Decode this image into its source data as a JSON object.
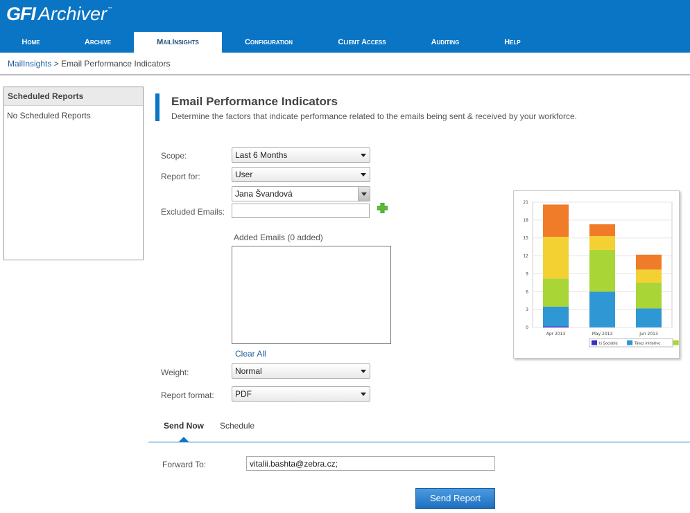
{
  "header": {
    "logo": {
      "brand": "GFI",
      "product": "Archiver",
      "tm": "™"
    },
    "nav": [
      {
        "label": "Home",
        "active": false
      },
      {
        "label": "Archive",
        "active": false
      },
      {
        "label": "MailInsights",
        "active": true
      },
      {
        "label": "Configuration",
        "active": false
      },
      {
        "label": "Client Access",
        "active": false
      },
      {
        "label": "Auditing",
        "active": false
      },
      {
        "label": "Help",
        "active": false
      }
    ]
  },
  "breadcrumb": {
    "link": "MailInsights",
    "separator": ">",
    "current": "Email Performance Indicators"
  },
  "sidebar": {
    "title": "Scheduled Reports",
    "empty_text": "No Scheduled Reports"
  },
  "page": {
    "title": "Email Performance Indicators",
    "description": "Determine the factors that indicate performance related to the emails being sent & received by your workforce."
  },
  "form": {
    "scope_label": "Scope:",
    "scope_value": "Last 6 Months",
    "report_for_label": "Report for:",
    "report_for_value": "User",
    "user_value": "Jana Švandová",
    "excluded_label": "Excluded Emails:",
    "excluded_value": "",
    "added_label": "Added Emails (0 added)",
    "clear_all": "Clear All",
    "weight_label": "Weight:",
    "weight_value": "Normal",
    "format_label": "Report format:",
    "format_value": "PDF"
  },
  "tabs": {
    "send_now": "Send Now",
    "schedule": "Schedule"
  },
  "send": {
    "forward_label": "Forward To:",
    "forward_value": "vitalii.bashta@zebra.cz;",
    "button": "Send Report"
  },
  "colors": {
    "accent": "#0a75c5",
    "add_icon": "#5bbf35"
  },
  "chart_data": {
    "type": "bar",
    "stacked": true,
    "categories": [
      "Apr 2013",
      "May 2013",
      "Jun 2013"
    ],
    "ylim": [
      0,
      21
    ],
    "yticks": [
      0,
      3,
      6,
      9,
      12,
      15,
      18,
      21
    ],
    "grid": true,
    "legend_position": "bottom-right",
    "series": [
      {
        "name": "",
        "color": "#3b2fc9",
        "values": [
          0.2,
          0,
          0
        ]
      },
      {
        "name": "",
        "color": "#2e97d4",
        "values": [
          3.3,
          6,
          3.2
        ]
      },
      {
        "name": "",
        "color": "#a9d536",
        "values": [
          4.7,
          7,
          4.3
        ]
      },
      {
        "name": "",
        "color": "#f3d133",
        "values": [
          7,
          2.3,
          2.2
        ]
      },
      {
        "name": "",
        "color": "#f07c2a",
        "values": [
          5.4,
          2,
          2.5
        ]
      }
    ],
    "legend": [
      {
        "label": "Is Sociable",
        "color": "#3b2fc9"
      },
      {
        "label": "Takes Initiative",
        "color": "#2e97d4"
      },
      {
        "label": "",
        "color": "#a9d536"
      }
    ]
  }
}
